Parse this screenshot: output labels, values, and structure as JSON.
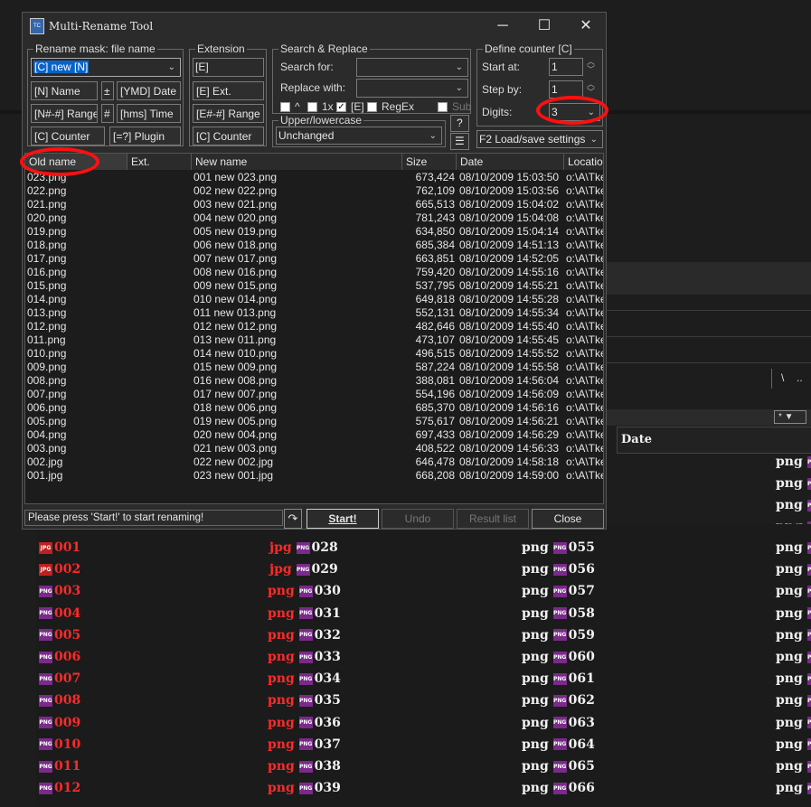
{
  "background": {
    "header_date": "Date",
    "path_chars": [
      "\\",
      ".."
    ],
    "sort_marker": "*",
    "rows": [
      {
        "n1": "001",
        "e1": "jpg",
        "n2": "028",
        "e2": "png",
        "n3": "055",
        "t1": "jpg",
        "t2": "png",
        "t3": "png"
      },
      {
        "n1": "002",
        "e1": "jpg",
        "n2": "029",
        "e2": "png",
        "n3": "056",
        "t1": "jpg",
        "t2": "png",
        "t3": "png"
      },
      {
        "n1": "003",
        "e1": "png",
        "n2": "030",
        "e2": "png",
        "n3": "057",
        "t1": "png",
        "t2": "png",
        "t3": "png"
      },
      {
        "n1": "004",
        "e1": "png",
        "n2": "031",
        "e2": "png",
        "n3": "058",
        "t1": "png",
        "t2": "png",
        "t3": "png"
      },
      {
        "n1": "005",
        "e1": "png",
        "n2": "032",
        "e2": "png",
        "n3": "059",
        "t1": "png",
        "t2": "png",
        "t3": "png"
      },
      {
        "n1": "006",
        "e1": "png",
        "n2": "033",
        "e2": "png",
        "n3": "060",
        "t1": "png",
        "t2": "png",
        "t3": "png"
      },
      {
        "n1": "007",
        "e1": "png",
        "n2": "034",
        "e2": "png",
        "n3": "061",
        "t1": "png",
        "t2": "png",
        "t3": "png"
      },
      {
        "n1": "008",
        "e1": "png",
        "n2": "035",
        "e2": "png",
        "n3": "062",
        "t1": "png",
        "t2": "png",
        "t3": "png"
      },
      {
        "n1": "009",
        "e1": "png",
        "n2": "036",
        "e2": "png",
        "n3": "063",
        "t1": "png",
        "t2": "png",
        "t3": "png"
      },
      {
        "n1": "010",
        "e1": "png",
        "n2": "037",
        "e2": "png",
        "n3": "064",
        "t1": "png",
        "t2": "png",
        "t3": "png"
      },
      {
        "n1": "011",
        "e1": "png",
        "n2": "038",
        "e2": "png",
        "n3": "065",
        "t1": "png",
        "t2": "png",
        "t3": "png"
      },
      {
        "n1": "012",
        "e1": "png",
        "n2": "039",
        "e2": "png",
        "n3": "066",
        "t1": "png",
        "t2": "png",
        "t3": "png"
      }
    ],
    "right_col_ext": "png",
    "top_rows_ext": "png"
  },
  "dialog": {
    "title": "Multi-Rename Tool",
    "rename_mask": {
      "title": "Rename mask: file name",
      "value": "[C] new [N]",
      "buttons": [
        "[N]  Name",
        "±",
        "[YMD]  Date",
        "[N#-#]  Range",
        "#",
        "[hms]  Time",
        "[C]  Counter",
        "[=?]  Plugin"
      ]
    },
    "extension": {
      "title": "Extension",
      "value": "[E]",
      "buttons": [
        "[E]  Ext.",
        "[E#-#]  Range",
        "[C]  Counter"
      ]
    },
    "search_replace": {
      "title": "Search & Replace",
      "search_label": "Search for:",
      "replace_label": "Replace with:",
      "search_value": "",
      "replace_value": "",
      "opt_caret": "^",
      "opt_1x": "1x",
      "opt_e": "[E]",
      "opt_regex": "RegEx",
      "opt_sub": "Sub"
    },
    "case": {
      "title": "Upper/lowercase",
      "value": "Unchanged",
      "help": "?"
    },
    "counter": {
      "title": "Define counter [C]",
      "start_label": "Start at:",
      "start_value": "1",
      "step_label": "Step by:",
      "step_value": "1",
      "digits_label": "Digits:",
      "digits_value": "3",
      "load_save": "F2 Load/save settings"
    },
    "columns": [
      "Old name",
      "Ext.",
      "New name",
      "Size",
      "Date",
      "Location"
    ],
    "files": [
      {
        "old": "023.png",
        "new": "001 new 023.png",
        "size": "673,424",
        "date": "08/10/2009 15:03:50",
        "loc": "o:\\A\\Tke"
      },
      {
        "old": "022.png",
        "new": "002 new 022.png",
        "size": "762,109",
        "date": "08/10/2009 15:03:56",
        "loc": "o:\\A\\Tke"
      },
      {
        "old": "021.png",
        "new": "003 new 021.png",
        "size": "665,513",
        "date": "08/10/2009 15:04:02",
        "loc": "o:\\A\\Tke"
      },
      {
        "old": "020.png",
        "new": "004 new 020.png",
        "size": "781,243",
        "date": "08/10/2009 15:04:08",
        "loc": "o:\\A\\Tke"
      },
      {
        "old": "019.png",
        "new": "005 new 019.png",
        "size": "634,850",
        "date": "08/10/2009 15:04:14",
        "loc": "o:\\A\\Tke"
      },
      {
        "old": "018.png",
        "new": "006 new 018.png",
        "size": "685,384",
        "date": "08/10/2009 14:51:13",
        "loc": "o:\\A\\Tke"
      },
      {
        "old": "017.png",
        "new": "007 new 017.png",
        "size": "663,851",
        "date": "08/10/2009 14:52:05",
        "loc": "o:\\A\\Tke"
      },
      {
        "old": "016.png",
        "new": "008 new 016.png",
        "size": "759,420",
        "date": "08/10/2009 14:55:16",
        "loc": "o:\\A\\Tke"
      },
      {
        "old": "015.png",
        "new": "009 new 015.png",
        "size": "537,795",
        "date": "08/10/2009 14:55:21",
        "loc": "o:\\A\\Tke"
      },
      {
        "old": "014.png",
        "new": "010 new 014.png",
        "size": "649,818",
        "date": "08/10/2009 14:55:28",
        "loc": "o:\\A\\Tke"
      },
      {
        "old": "013.png",
        "new": "011 new 013.png",
        "size": "552,131",
        "date": "08/10/2009 14:55:34",
        "loc": "o:\\A\\Tke"
      },
      {
        "old": "012.png",
        "new": "012 new 012.png",
        "size": "482,646",
        "date": "08/10/2009 14:55:40",
        "loc": "o:\\A\\Tke"
      },
      {
        "old": "011.png",
        "new": "013 new 011.png",
        "size": "473,107",
        "date": "08/10/2009 14:55:45",
        "loc": "o:\\A\\Tke"
      },
      {
        "old": "010.png",
        "new": "014 new 010.png",
        "size": "496,515",
        "date": "08/10/2009 14:55:52",
        "loc": "o:\\A\\Tke"
      },
      {
        "old": "009.png",
        "new": "015 new 009.png",
        "size": "587,224",
        "date": "08/10/2009 14:55:58",
        "loc": "o:\\A\\Tke"
      },
      {
        "old": "008.png",
        "new": "016 new 008.png",
        "size": "388,081",
        "date": "08/10/2009 14:56:04",
        "loc": "o:\\A\\Tke"
      },
      {
        "old": "007.png",
        "new": "017 new 007.png",
        "size": "554,196",
        "date": "08/10/2009 14:56:09",
        "loc": "o:\\A\\Tke"
      },
      {
        "old": "006.png",
        "new": "018 new 006.png",
        "size": "685,370",
        "date": "08/10/2009 14:56:16",
        "loc": "o:\\A\\Tke"
      },
      {
        "old": "005.png",
        "new": "019 new 005.png",
        "size": "575,617",
        "date": "08/10/2009 14:56:21",
        "loc": "o:\\A\\Tke"
      },
      {
        "old": "004.png",
        "new": "020 new 004.png",
        "size": "697,433",
        "date": "08/10/2009 14:56:29",
        "loc": "o:\\A\\Tke"
      },
      {
        "old": "003.png",
        "new": "021 new 003.png",
        "size": "408,522",
        "date": "08/10/2009 14:56:33",
        "loc": "o:\\A\\Tke"
      },
      {
        "old": "002.jpg",
        "new": "022 new 002.jpg",
        "size": "646,478",
        "date": "08/10/2009 14:58:18",
        "loc": "o:\\A\\Tke"
      },
      {
        "old": "001.jpg",
        "new": "023 new 001.jpg",
        "size": "668,208",
        "date": "08/10/2009 14:59:00",
        "loc": "o:\\A\\Tke"
      }
    ],
    "status_text": "Please press 'Start!' to start renaming!",
    "buttons": {
      "start": "Start!",
      "undo": "Undo",
      "result": "Result list",
      "close": "Close"
    }
  }
}
